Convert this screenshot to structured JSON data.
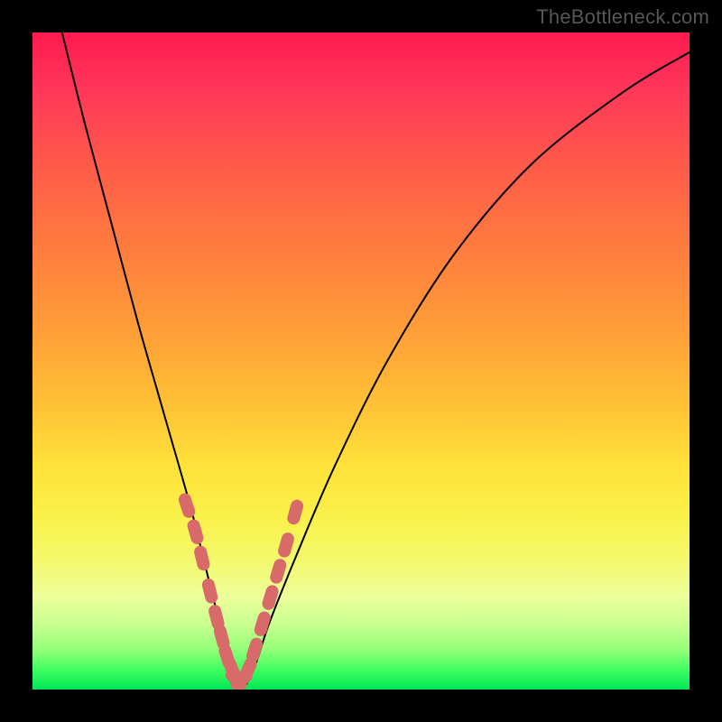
{
  "watermark": "TheBottleneck.com",
  "colors": {
    "frame": "#000000",
    "curve": "#000000",
    "marker": "#d86a6a",
    "gradient_stops": [
      "#ff1a4d",
      "#ff345a",
      "#ff5a49",
      "#ff7a3f",
      "#ff9a38",
      "#ffbf35",
      "#ffe23a",
      "#f9f24a",
      "#f4f86a",
      "#ecff9a",
      "#c9ff8f",
      "#92ff78",
      "#3fff60",
      "#00e756"
    ]
  },
  "chart_data": {
    "type": "line",
    "title": "",
    "xlabel": "",
    "ylabel": "",
    "xlim": [
      0,
      100
    ],
    "ylim": [
      0,
      100
    ],
    "note": "Curve is a V-shaped bottleneck dip. x and y in percent of plot area (y=0 bottom, y=100 top). Minimum near x≈31, y≈0.",
    "series": [
      {
        "name": "bottleneck-curve",
        "x": [
          4.5,
          8,
          12,
          16,
          20,
          24,
          26,
          28,
          30,
          31,
          32,
          34,
          36,
          40,
          46,
          54,
          64,
          76,
          90,
          100
        ],
        "y": [
          100,
          86,
          71,
          56,
          42,
          28,
          20,
          12,
          4,
          0,
          0,
          4,
          10,
          20,
          34,
          50,
          66,
          80,
          91,
          97
        ]
      }
    ],
    "markers": {
      "name": "highlight-lozenges",
      "note": "Salmon rounded-capsule markers scattered along both flanks near the trough (approx 65–85% depth).",
      "points_xy": [
        [
          23.5,
          28
        ],
        [
          24.8,
          24
        ],
        [
          25.8,
          20
        ],
        [
          27.0,
          15
        ],
        [
          28.0,
          11
        ],
        [
          28.8,
          8
        ],
        [
          29.6,
          5
        ],
        [
          30.4,
          3
        ],
        [
          31.0,
          1.5
        ],
        [
          31.8,
          1.5
        ],
        [
          32.8,
          3
        ],
        [
          33.8,
          6
        ],
        [
          35.0,
          10
        ],
        [
          36.2,
          14
        ],
        [
          37.4,
          18
        ],
        [
          38.6,
          22
        ],
        [
          40.0,
          27
        ]
      ]
    }
  }
}
